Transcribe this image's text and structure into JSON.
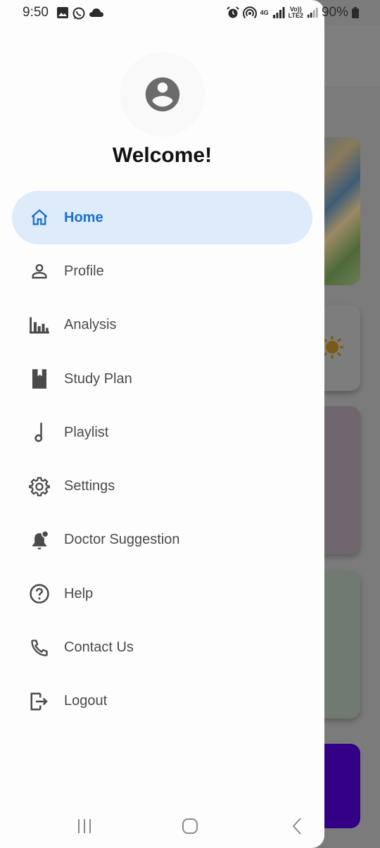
{
  "status_bar": {
    "time": "9:50",
    "network_4g": "4G",
    "volte_top": "Vo))",
    "volte_bottom": "LTE2",
    "battery": "90%"
  },
  "drawer": {
    "avatar_icon": "account-circle-icon",
    "welcome": "Welcome!",
    "items": [
      {
        "label": "Home",
        "icon": "home-icon",
        "active": true
      },
      {
        "label": "Profile",
        "icon": "person-icon",
        "active": false
      },
      {
        "label": "Analysis",
        "icon": "bar-chart-icon",
        "active": false
      },
      {
        "label": "Study Plan",
        "icon": "book-icon",
        "active": false
      },
      {
        "label": "Playlist",
        "icon": "music-note-icon",
        "active": false
      },
      {
        "label": "Settings",
        "icon": "gear-icon",
        "active": false
      },
      {
        "label": "Doctor Suggestion",
        "icon": "notification-bell-icon",
        "active": false
      },
      {
        "label": "Help",
        "icon": "help-circle-icon",
        "active": false
      },
      {
        "label": "Contact Us",
        "icon": "phone-icon",
        "active": false
      },
      {
        "label": "Logout",
        "icon": "logout-icon",
        "active": false
      }
    ]
  },
  "colors": {
    "accent": "#1a6fcf",
    "active_bg": "#deebfb",
    "scrim": "#7b7b7b",
    "purple_card": "#340085"
  }
}
